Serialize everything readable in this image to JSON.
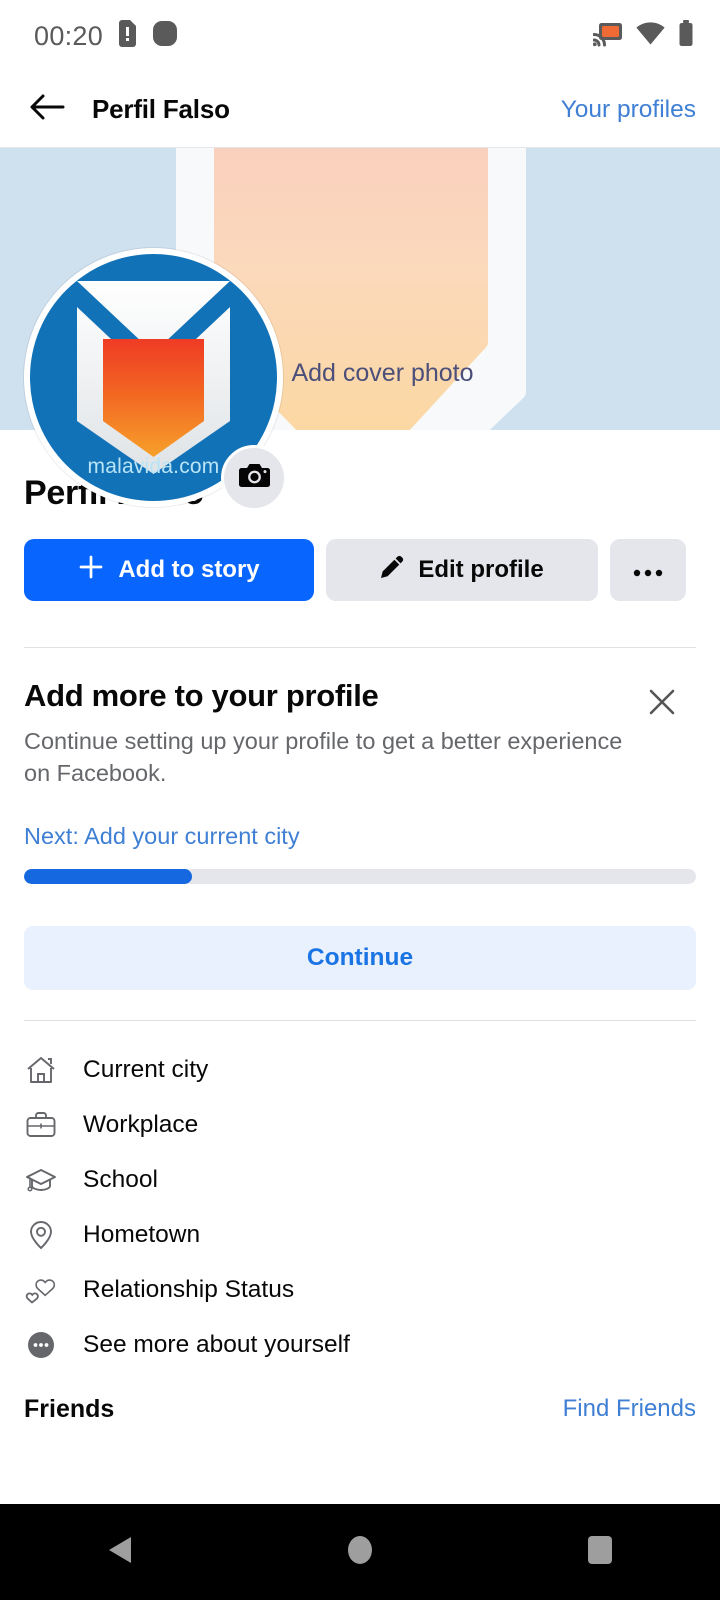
{
  "status_bar": {
    "time": "00:20",
    "icons": [
      "sim-alert-icon",
      "rounded-square-icon",
      "cast-icon",
      "wifi-icon",
      "battery-icon"
    ]
  },
  "app_bar": {
    "back_icon": "back-arrow-icon",
    "title": "Perfil Falso",
    "action_label": "Your profiles"
  },
  "cover": {
    "cta_label": "Add cover photo",
    "cta_icon": "camera-icon",
    "bg_color": "#cfe0ef",
    "cta_text_color": "#4b4f7a"
  },
  "avatar": {
    "watermark": "malavida.com",
    "bg_color": "#1272b8",
    "camera_badge_icon": "camera-icon"
  },
  "profile": {
    "name": "Perfil Falso"
  },
  "actions": {
    "add_story_label": "Add to story",
    "add_story_icon": "plus-icon",
    "add_story_color": "#0866ff",
    "edit_profile_label": "Edit profile",
    "edit_profile_icon": "pencil-icon",
    "more_icon": "ellipsis-icon"
  },
  "add_more": {
    "title": "Add more to your profile",
    "subtitle": "Continue setting up your profile to get a better experience on Facebook.",
    "next_label": "Next: Add your current city",
    "progress_percent": 25,
    "continue_label": "Continue",
    "close_icon": "close-icon"
  },
  "info_list": [
    {
      "label": "Current city",
      "icon": "house-icon"
    },
    {
      "label": "Workplace",
      "icon": "briefcase-icon"
    },
    {
      "label": "School",
      "icon": "graduation-cap-icon"
    },
    {
      "label": "Hometown",
      "icon": "location-pin-icon"
    },
    {
      "label": "Relationship Status",
      "icon": "hearts-icon"
    },
    {
      "label": "See more about yourself",
      "icon": "ellipsis-circle-icon"
    }
  ],
  "friends": {
    "title": "Friends",
    "link_label": "Find Friends"
  },
  "nav_bar": {
    "back_icon": "nav-back-triangle-icon",
    "home_icon": "nav-home-circle-icon",
    "recents_icon": "nav-recents-square-icon"
  }
}
